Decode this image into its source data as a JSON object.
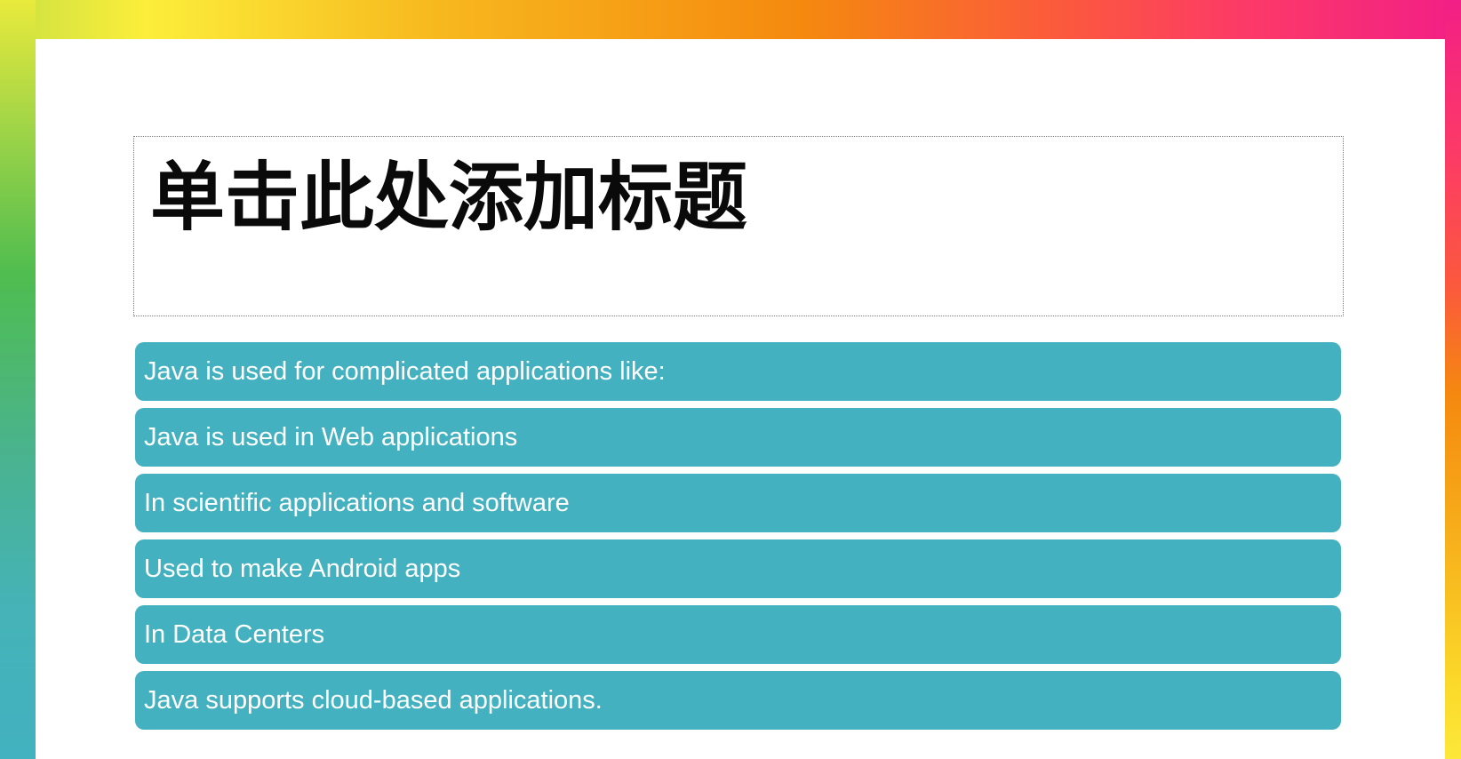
{
  "slide": {
    "title": "单击此处添加标题",
    "items": [
      "Java is used for complicated applications like:",
      "Java is used in Web applications",
      "In scientific applications and software",
      "Used to make Android apps",
      "In Data Centers",
      "Java supports cloud-based applications."
    ]
  },
  "colors": {
    "item_background": "#43b1bf",
    "item_text": "#ffffff",
    "title_text": "#0a0a0a"
  }
}
